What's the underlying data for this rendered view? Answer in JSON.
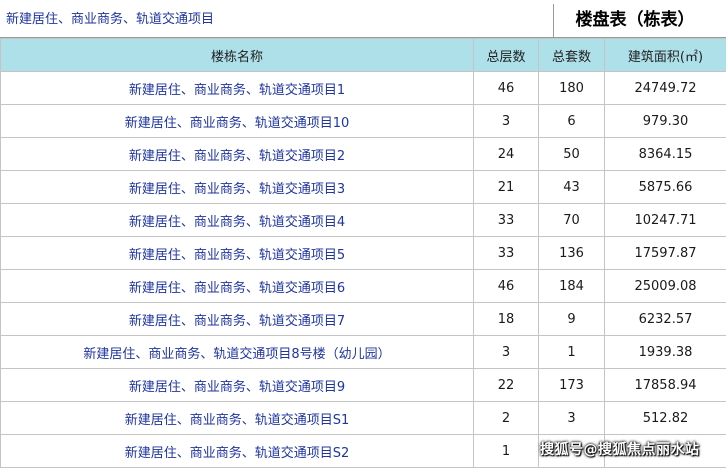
{
  "header": {
    "project_title": "新建居住、商业商务、轨道交通项目",
    "table_title": "楼盘表（栋表）"
  },
  "table": {
    "columns": [
      "楼栋名称",
      "总层数",
      "总套数",
      "建筑面积(㎡)"
    ],
    "rows": [
      {
        "name": "新建居住、商业商务、轨道交通项目1",
        "floors": "46",
        "units": "180",
        "area": "24749.72"
      },
      {
        "name": "新建居住、商业商务、轨道交通项目10",
        "floors": "3",
        "units": "6",
        "area": "979.30"
      },
      {
        "name": "新建居住、商业商务、轨道交通项目2",
        "floors": "24",
        "units": "50",
        "area": "8364.15"
      },
      {
        "name": "新建居住、商业商务、轨道交通项目3",
        "floors": "21",
        "units": "43",
        "area": "5875.66"
      },
      {
        "name": "新建居住、商业商务、轨道交通项目4",
        "floors": "33",
        "units": "70",
        "area": "10247.71"
      },
      {
        "name": "新建居住、商业商务、轨道交通项目5",
        "floors": "33",
        "units": "136",
        "area": "17597.87"
      },
      {
        "name": "新建居住、商业商务、轨道交通项目6",
        "floors": "46",
        "units": "184",
        "area": "25009.08"
      },
      {
        "name": "新建居住、商业商务、轨道交通项目7",
        "floors": "18",
        "units": "9",
        "area": "6232.57"
      },
      {
        "name": "新建居住、商业商务、轨道交通项目8号楼（幼儿园）",
        "floors": "3",
        "units": "1",
        "area": "1939.38"
      },
      {
        "name": "新建居住、商业商务、轨道交通项目9",
        "floors": "22",
        "units": "173",
        "area": "17858.94"
      },
      {
        "name": "新建居住、商业商务、轨道交通项目S1",
        "floors": "2",
        "units": "3",
        "area": "512.82"
      },
      {
        "name": "新建居住、商业商务、轨道交通项目S2",
        "floors": "1",
        "units": "",
        "area": ""
      }
    ]
  },
  "watermark": "搜狐号@搜狐焦点丽水站"
}
